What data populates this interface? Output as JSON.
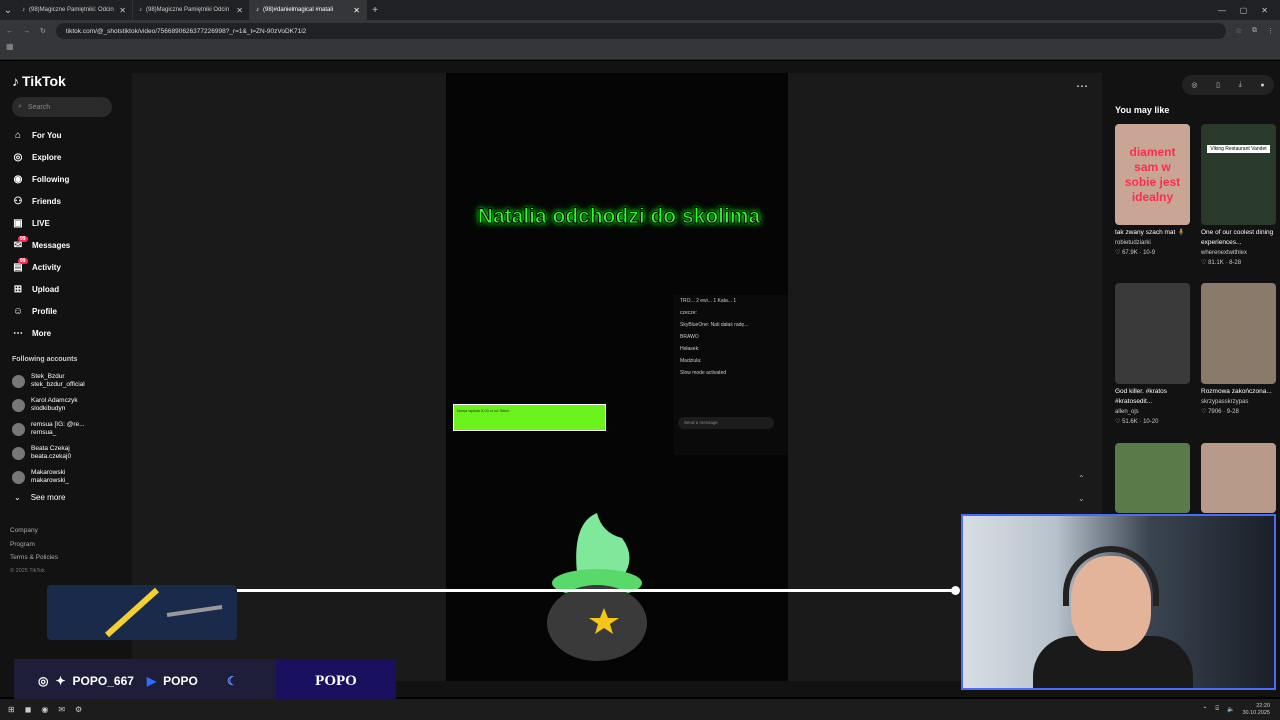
{
  "browser": {
    "tabs": [
      {
        "title": "(98)Magiczne Pamiętniki: Odcin",
        "active": false
      },
      {
        "title": "(98)Magiczne Pamiętniki Odcin",
        "active": false
      },
      {
        "title": "(98)#danielmagical #natali",
        "active": true
      }
    ],
    "url": "tiktok.com/@_shotstiktok/video/7566890626377226998?_r=1&_t=ZN-90zVoDK71i2"
  },
  "sidebar": {
    "logo": "TikTok",
    "search_placeholder": "Search",
    "nav": [
      {
        "label": "For You",
        "icon": "home-icon"
      },
      {
        "label": "Explore",
        "icon": "compass-icon"
      },
      {
        "label": "Following",
        "icon": "following-icon"
      },
      {
        "label": "Friends",
        "icon": "friends-icon"
      },
      {
        "label": "LIVE",
        "icon": "live-icon"
      },
      {
        "label": "Messages",
        "icon": "messages-icon",
        "badge": "99"
      },
      {
        "label": "Activity",
        "icon": "activity-icon",
        "badge": "99"
      },
      {
        "label": "Upload",
        "icon": "upload-icon"
      },
      {
        "label": "Profile",
        "icon": "profile-icon"
      },
      {
        "label": "More",
        "icon": "more-icon"
      }
    ],
    "following_heading": "Following accounts",
    "accounts": [
      {
        "name": "Stek_Bzdur",
        "handle": "stek_bzdur_official"
      },
      {
        "name": "Karol Adamczyk",
        "handle": "slodkibudyn"
      },
      {
        "name": "remsua [IG: @re...",
        "handle": "remsua_"
      },
      {
        "name": "Beata Czekaj",
        "handle": "beata.czekaj0"
      },
      {
        "name": "Makarowski",
        "handle": "makarowski_"
      }
    ],
    "see_more": "See more",
    "footer": [
      "Company",
      "Program",
      "Terms & Policies"
    ],
    "copyright": "© 2025 TikTok"
  },
  "video": {
    "caption": "Natalia odchodzi do skolima",
    "chat_tabs": "TRO... 2  ewi... 1  Kata... 1",
    "chat_lines": [
      "czecze:",
      "SkyBlueOne: Nati dałaś radę...",
      "BRAWO",
      "Hełasek:",
      "Madziula:"
    ],
    "chat_mode": "Slow mode activated",
    "chat_input": "Send a message",
    "donation_text": "Nowa wpłata 5,00 zł od Stitch"
  },
  "right": {
    "heading": "You may like",
    "cards": [
      {
        "title": "tak zwany szach mat 🧍",
        "user": "robietudziarki",
        "likes": "67.9K",
        "date": "10-9",
        "thumb_color": "#c9a596",
        "thumb_text": "diament sam w sobie jest idealny"
      },
      {
        "title": "One of our coolest dining experiences...",
        "user": "wherenextwithlex",
        "likes": "81.1K",
        "date": "8-28",
        "thumb_color": "#2a3a2a",
        "thumb_text": "Viking Restaurant Vandet"
      },
      {
        "title": "God killer. #kratos #kratosedit...",
        "user": "allen_ojs",
        "likes": "51.6K",
        "date": "10-20",
        "thumb_color": "#3a3a3a",
        "thumb_text": ""
      },
      {
        "title": "Rozmowa zakończona...",
        "user": "skrzypasskrzypas",
        "likes": "7906",
        "date": "9-28",
        "thumb_color": "#8a7a6a",
        "thumb_text": ""
      },
      {
        "title": "",
        "user": "",
        "likes": "",
        "date": "",
        "thumb_color": "#5a7a4a",
        "thumb_text": ""
      },
      {
        "title": "",
        "user": "",
        "likes": "",
        "date": "",
        "thumb_color": "#b89a8a",
        "thumb_text": ""
      }
    ]
  },
  "overlay": {
    "handle": "POPO_667",
    "youtube": "POPO",
    "brand": "POPO"
  },
  "taskbar": {
    "time": "22:20",
    "date": "30.10.2025"
  }
}
